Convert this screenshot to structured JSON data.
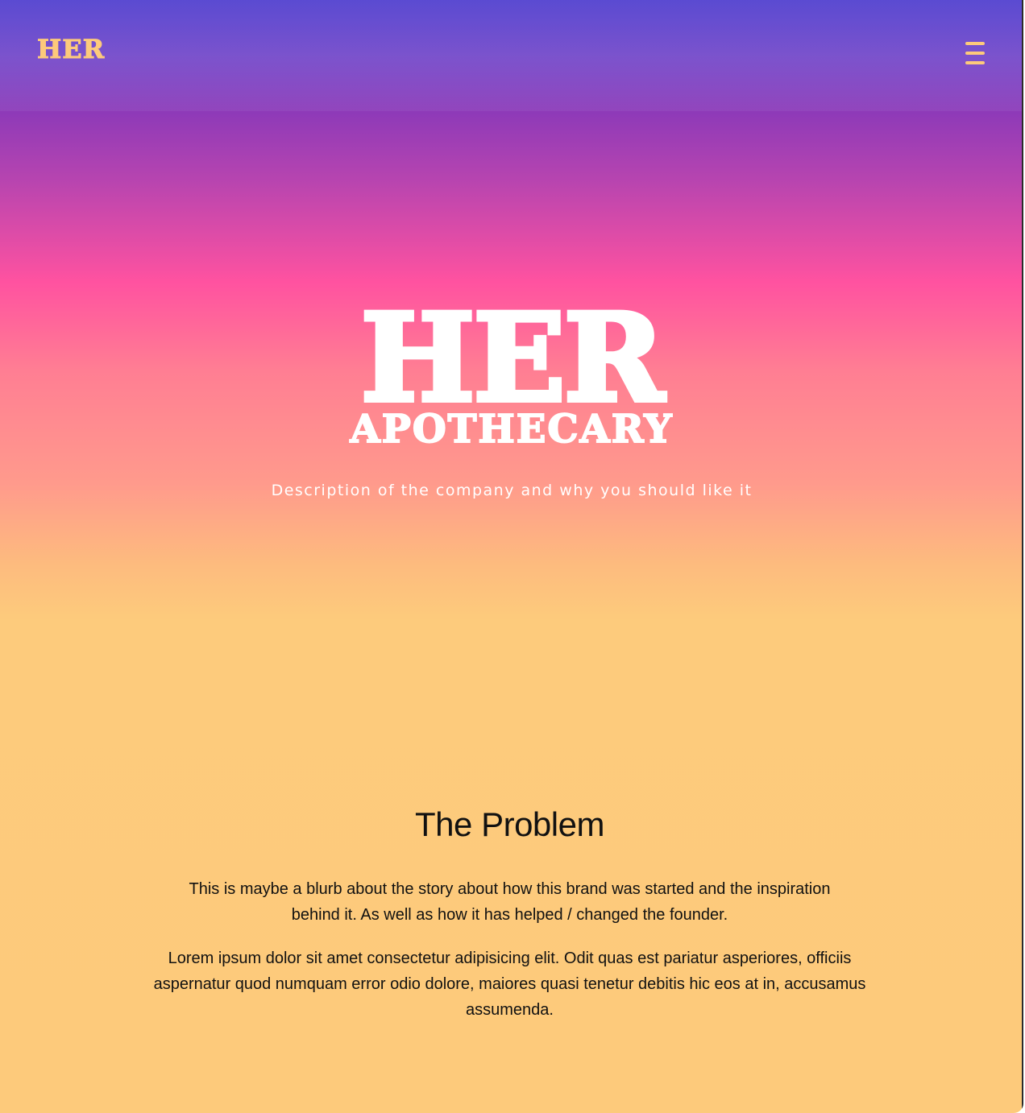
{
  "navbar": {
    "logo": "HER",
    "menu_icon": "hamburger-menu-icon"
  },
  "hero": {
    "title": "HER",
    "subtitle": "APOTHECARY",
    "description": "Description of the company and why you should like it"
  },
  "problem": {
    "heading": "The Problem",
    "paragraphs": [
      "This is maybe a blurb about the story about how this brand was started and the inspiration behind it. As well as how it has helped / changed the founder.",
      "Lorem ipsum dolor sit amet consectetur adipisicing elit. Odit quas est pariatur asperiores, officiis aspernatur quod numquam error odio dolore, maiores quasi tenetur debitis hic eos at in, accusamus assumenda."
    ]
  },
  "colors": {
    "accent": "#fdca7b",
    "gradient_top": "#5b4bd1",
    "gradient_pink": "#ff52a0",
    "gradient_bottom": "#fdca7b",
    "text_light": "#ffffff",
    "text_dark": "#111111"
  }
}
